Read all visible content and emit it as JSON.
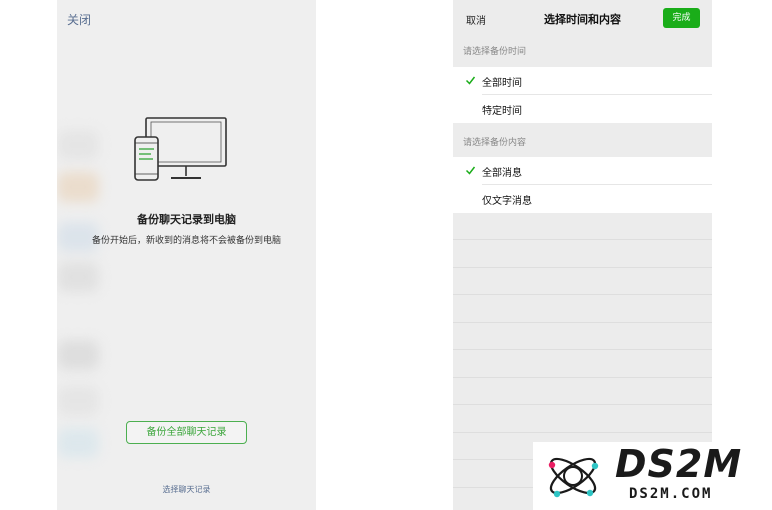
{
  "left": {
    "close_label": "关闭",
    "title": "备份聊天记录到电脑",
    "subtitle": "备份开始后，新收到的消息将不会被备份到电脑",
    "backup_all_label": "备份全部聊天记录",
    "select_records_label": "选择聊天记录"
  },
  "right": {
    "cancel_label": "取消",
    "title": "选择时间和内容",
    "done_label": "完成",
    "time_section": {
      "header": "请选择备份时间",
      "options": [
        {
          "label": "全部时间",
          "selected": true
        },
        {
          "label": "特定时间",
          "selected": false
        }
      ]
    },
    "content_section": {
      "header": "请选择备份内容",
      "options": [
        {
          "label": "全部消息",
          "selected": true
        },
        {
          "label": "仅文字消息",
          "selected": false
        }
      ]
    }
  },
  "watermark": {
    "main": "DS2M",
    "sub": "DS2M.COM"
  },
  "colors": {
    "accent_green": "#1aad19",
    "link_blue": "#5a6f91",
    "check_green": "#1aad19"
  }
}
